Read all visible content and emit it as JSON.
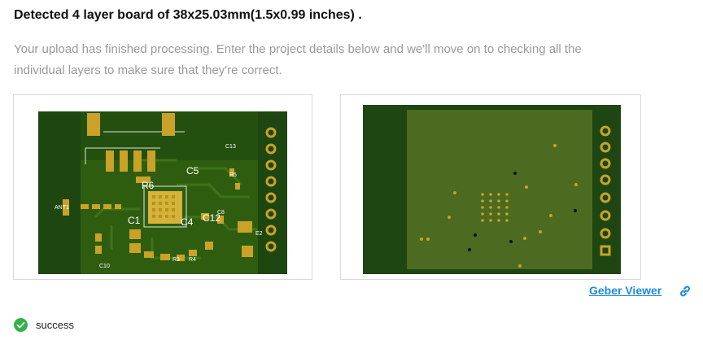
{
  "headline": "Detected 4 layer board of 38x25.03mm(1.5x0.99 inches) .",
  "description": "Your upload has finished processing. Enter the project details below and we'll move on to checking all the individual layers to make sure that they're correct.",
  "previews": {
    "top": {
      "labels": [
        "C5",
        "R6",
        "C4",
        "C1",
        "C12",
        "C8",
        "C13",
        "R5",
        "C10",
        "R3",
        "R4",
        "ANT1",
        "E2"
      ]
    },
    "bottom": {}
  },
  "viewer_link": "Geber Viewer",
  "status_text": "success",
  "colors": {
    "board_dark": "#1d4612",
    "board_mid": "#2d5a12",
    "board_light": "#4e6a21",
    "pad_gold": "#c9a227",
    "link_blue": "#1a8be0",
    "success_green": "#32b24a"
  },
  "icons": {
    "link": "chain-link-icon",
    "status": "check-circle-icon"
  }
}
